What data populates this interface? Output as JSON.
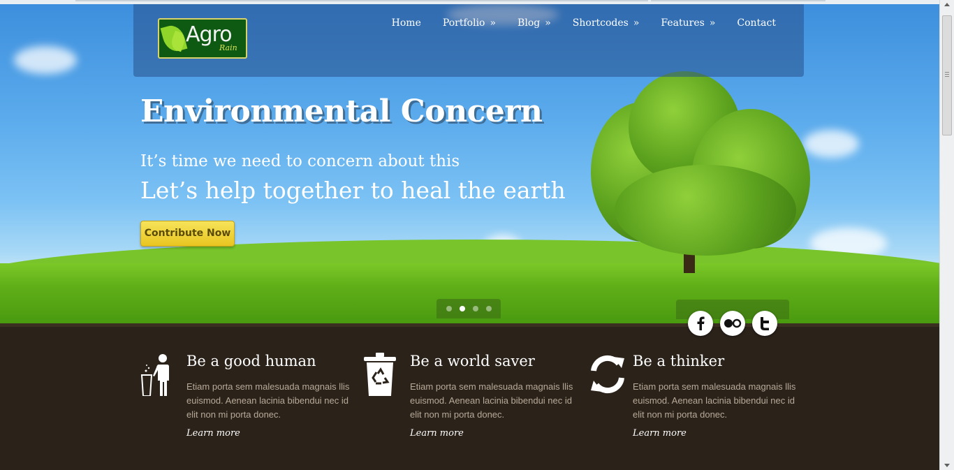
{
  "brand": {
    "name": "Agro",
    "tagline": "Rain"
  },
  "nav": {
    "items": [
      {
        "label": "Home",
        "has_submenu": false
      },
      {
        "label": "Portfolio",
        "has_submenu": true
      },
      {
        "label": "Blog",
        "has_submenu": true
      },
      {
        "label": "Shortcodes",
        "has_submenu": true
      },
      {
        "label": "Features",
        "has_submenu": true
      },
      {
        "label": "Contact",
        "has_submenu": false
      }
    ],
    "submenu_marker": "»"
  },
  "hero": {
    "title": "Environmental Concern",
    "subtitle": "It’s time we need to concern about this",
    "headline": "Let’s help together to heal the earth",
    "cta_label": "Contribute Now",
    "slides_total": 4,
    "active_slide": 2
  },
  "social": [
    {
      "name": "facebook",
      "glyph": "f",
      "icon": "facebook-icon"
    },
    {
      "name": "flickr",
      "glyph": "●○",
      "icon": "flickr-icon"
    },
    {
      "name": "twitter",
      "glyph": "t",
      "icon": "twitter-icon"
    }
  ],
  "features": [
    {
      "title": "Be a good human",
      "text": "Etiam porta sem malesuada magnais llis euismod. Aenean lacinia bibendui nec id elit non mi porta donec.",
      "link": "Learn more",
      "icon": "trash-person-icon"
    },
    {
      "title": "Be a world saver",
      "text": "Etiam porta sem malesuada magnais llis euismod. Aenean lacinia bibendui nec id elit non mi porta donec.",
      "link": "Learn more",
      "icon": "recycle-bin-icon"
    },
    {
      "title": "Be a thinker",
      "text": "Etiam porta sem malesuada magnais llis euismod. Aenean lacinia bibendui nec id elit non mi porta donec.",
      "link": "Learn more",
      "icon": "refresh-icon"
    }
  ],
  "colors": {
    "cta": "#e9c521",
    "band": "#2b221a",
    "header_overlay": "#28508c",
    "text_muted": "#b8aa98"
  }
}
